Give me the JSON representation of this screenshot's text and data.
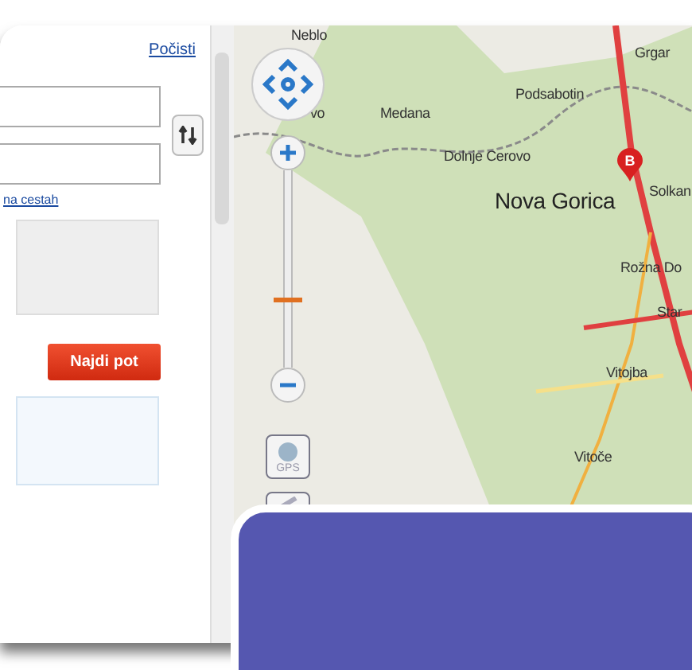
{
  "sidebar": {
    "clear_link": "Počisti",
    "road_link": "na cestah",
    "find_button": "Najdi pot"
  },
  "map": {
    "labels": [
      {
        "text": "Neblo",
        "kind": "place"
      },
      {
        "text": "vo",
        "kind": "place"
      },
      {
        "text": "Medana",
        "kind": "place"
      },
      {
        "text": "Podsabotin",
        "kind": "place"
      },
      {
        "text": "Grgar",
        "kind": "place"
      },
      {
        "text": "Dolnje Cerovo",
        "kind": "place"
      },
      {
        "text": "Nova Gorica",
        "kind": "city"
      },
      {
        "text": "Solkan",
        "kind": "place"
      },
      {
        "text": "Rožna Do",
        "kind": "place"
      },
      {
        "text": "Star",
        "kind": "place"
      },
      {
        "text": "Vitojba",
        "kind": "place"
      },
      {
        "text": "Vitoče",
        "kind": "place"
      }
    ],
    "marker": "B",
    "zoom": {
      "level": 0.33
    },
    "gps_button": "GPS"
  }
}
